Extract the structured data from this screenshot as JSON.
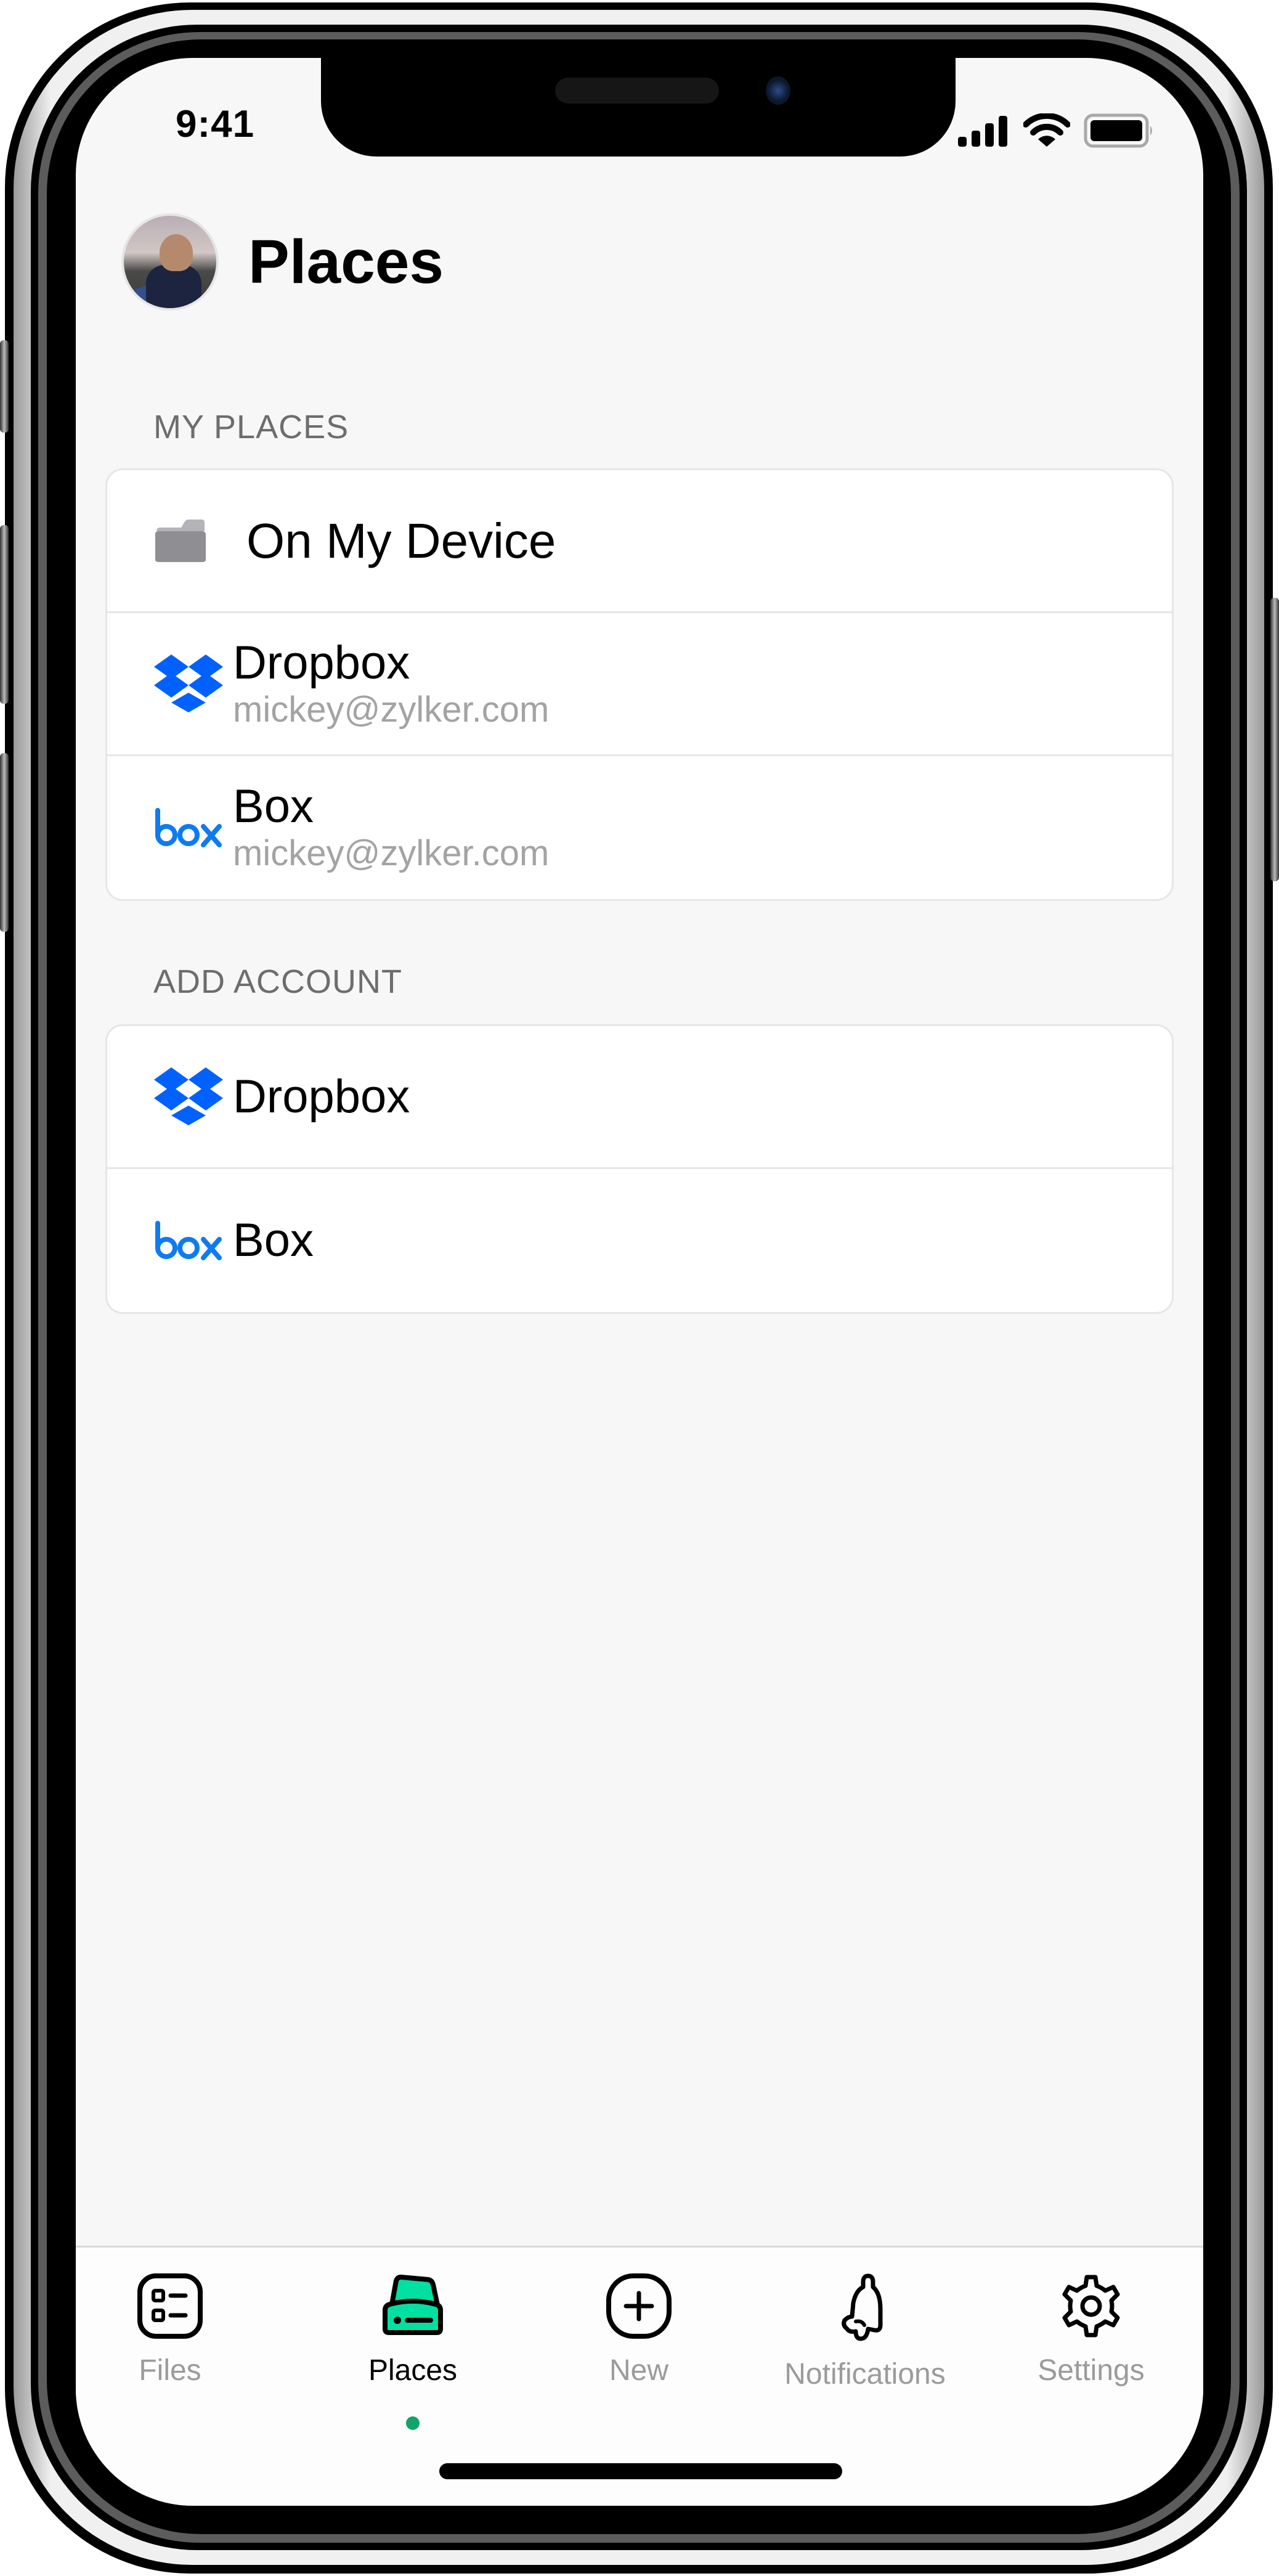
{
  "status_bar": {
    "time": "9:41",
    "icons": [
      "cellular-signal-icon",
      "wifi-icon",
      "battery-icon"
    ]
  },
  "header": {
    "avatar": "user-avatar",
    "title": "Places"
  },
  "my_places": {
    "label": "MY PLACES",
    "items": [
      {
        "icon": "folder-icon",
        "title": "On My Device",
        "subtitle": null
      },
      {
        "icon": "dropbox-icon",
        "title": "Dropbox",
        "subtitle": "mickey@zylker.com"
      },
      {
        "icon": "box-icon",
        "title": "Box",
        "subtitle": "mickey@zylker.com"
      }
    ]
  },
  "add_account": {
    "label": "ADD ACCOUNT",
    "items": [
      {
        "icon": "dropbox-icon",
        "title": "Dropbox"
      },
      {
        "icon": "box-icon",
        "title": "Box"
      }
    ]
  },
  "tabbar": {
    "items": [
      {
        "icon": "files-list-icon",
        "label": "Files",
        "active": false
      },
      {
        "icon": "drive-icon",
        "label": "Places",
        "active": true
      },
      {
        "icon": "plus-square-icon",
        "label": "New",
        "active": false
      },
      {
        "icon": "bell-icon",
        "label": "Notifications",
        "active": false
      },
      {
        "icon": "gear-icon",
        "label": "Settings",
        "active": false
      }
    ]
  },
  "colors": {
    "accent_green": "#12a36a",
    "places_icon_fill": "#00e0a0",
    "dropbox_blue": "#0061fe",
    "box_blue": "#0f7bf0",
    "folder_gray": "#8e8e93",
    "background": "#f7f7f7",
    "inactive_tab": "#9b9b9b",
    "section_label": "#6d6d6d",
    "subtitle": "#a3a3a3"
  }
}
